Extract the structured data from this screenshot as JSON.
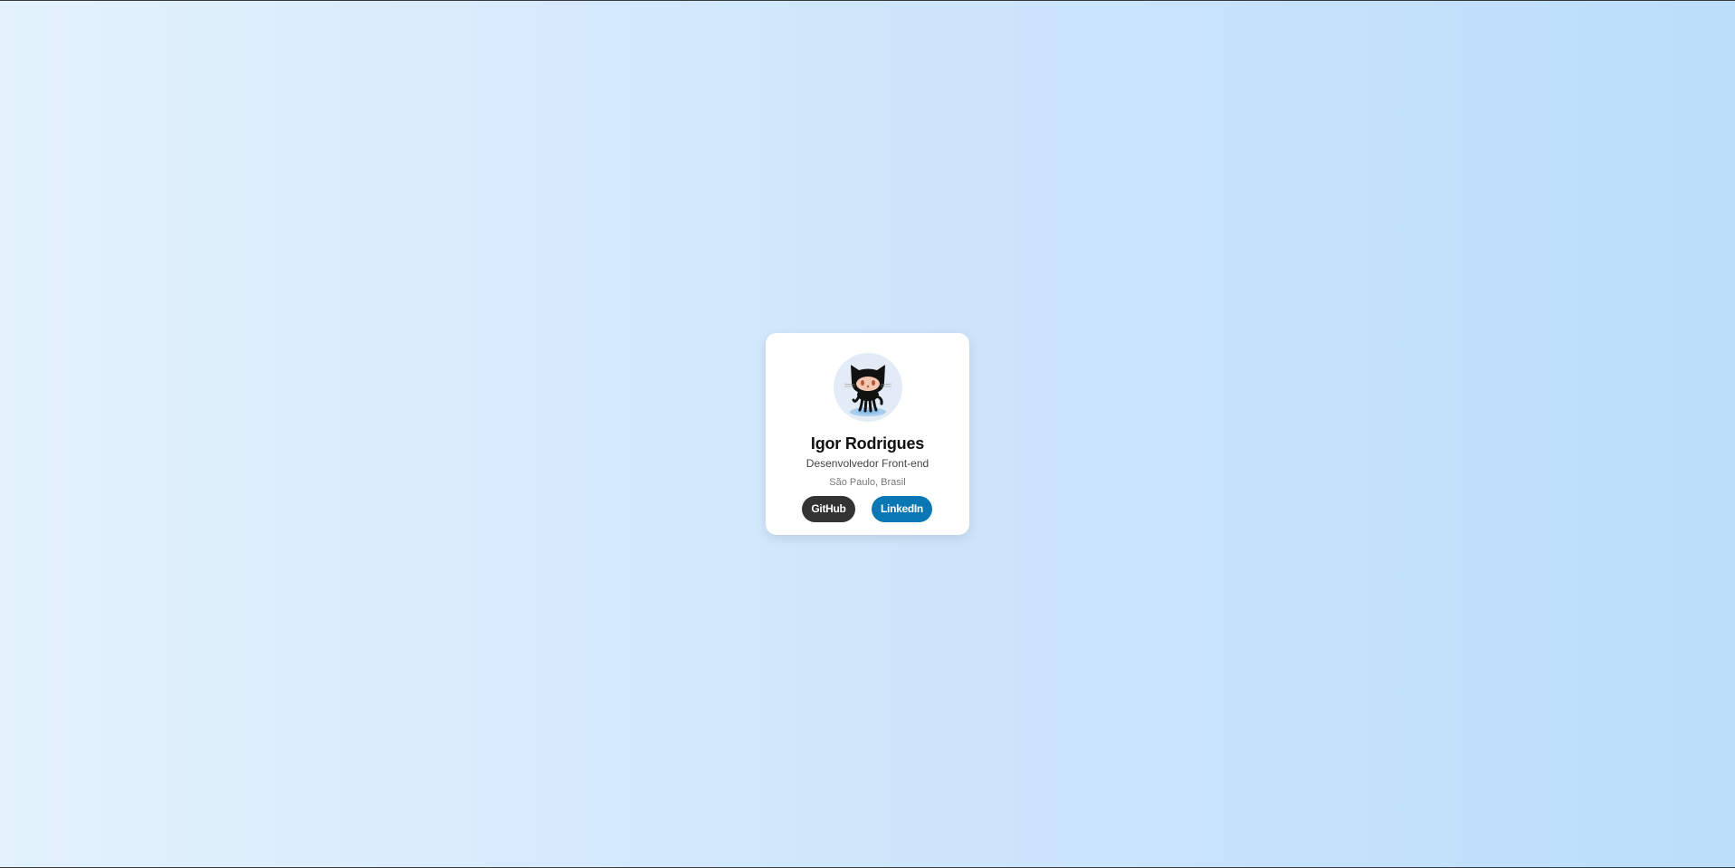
{
  "profile": {
    "avatar_icon": "octocat-icon",
    "name": "Igor Rodrigues",
    "role": "Desenvolvedor Front-end",
    "location": "São Paulo, Brasil"
  },
  "links": {
    "github_label": "GitHub",
    "linkedin_label": "LinkedIn"
  },
  "colors": {
    "background_start": "#e3f2fd",
    "background_end": "#bbdefb",
    "github_button": "#333333",
    "linkedin_button": "#0a77b5"
  }
}
